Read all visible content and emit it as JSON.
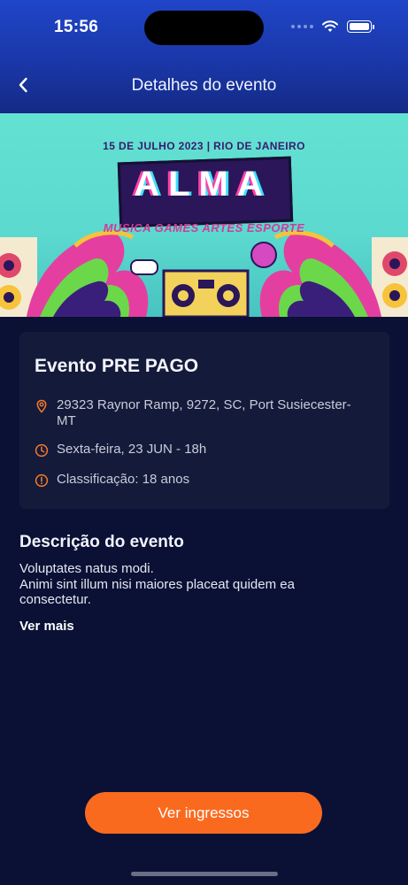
{
  "status": {
    "time": "15:56"
  },
  "header": {
    "title": "Detalhes do evento",
    "back_icon": "chevron-left-icon"
  },
  "banner": {
    "date_line": "15 DE JULHO 2023 | RIO DE JANEIRO",
    "logo": "ALMA",
    "subtitle": "MUSICA GAMES ARTES ESPORTE"
  },
  "event": {
    "name": "Evento PRE PAGO",
    "address_line1": "29323 Raynor Ramp, 9272, SC, Port Susiecester-",
    "address_line2": "MT",
    "date": "Sexta-feira,  23 JUN - 18h",
    "rating": "Classificação: 18 anos"
  },
  "description": {
    "title": "Descrição do evento",
    "line1": "Voluptates natus modi.",
    "line2": "Animi sint illum nisi maiores placeat quidem ea",
    "line3": "consectetur.",
    "more_label": "Ver mais"
  },
  "cta": {
    "label": "Ver ingressos"
  },
  "colors": {
    "accent": "#f96a1f",
    "background": "#0a1135",
    "card": "#141a3a",
    "header": "#1a37a8"
  }
}
